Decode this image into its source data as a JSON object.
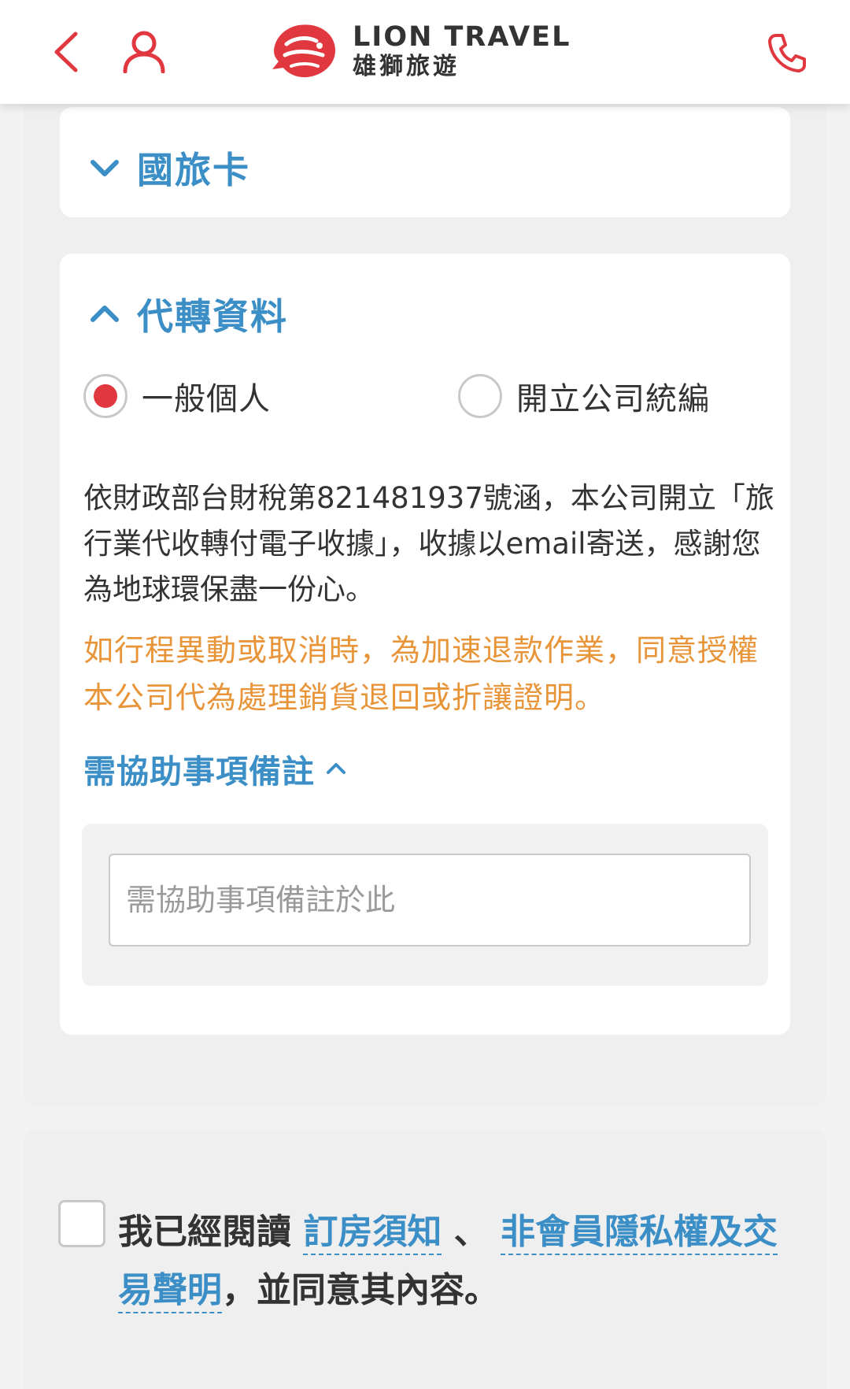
{
  "header": {
    "logo_en": "LION TRAVEL",
    "logo_zh": "雄獅旅遊",
    "icons": [
      "chevron-left-icon",
      "user-icon",
      "phone-icon"
    ],
    "accent_color": "#e1373f"
  },
  "travel_card": {
    "title": "國旅卡",
    "expanded": false
  },
  "agent_section": {
    "title": "代轉資料",
    "expanded": true,
    "options": [
      {
        "label": "一般個人",
        "selected": true
      },
      {
        "label": "開立公司統編",
        "selected": false
      }
    ],
    "description": "依財政部台財稅第821481937號涵，本公司開立「旅行業代收轉付電子收據」，收據以email寄送，感謝您為地球環保盡一份心。",
    "notice": "如行程異動或取消時，為加速退款作業，同意授權本公司代為處理銷貨退回或折讓證明。",
    "assist_toggle": "需協助事項備註",
    "assist_placeholder": "需協助事項備註於此"
  },
  "agreement": {
    "prefix": "我已經閱讀",
    "link1": "訂房須知",
    "separator": "、",
    "link2": "非會員隱私權及交易聲明",
    "suffix": "，並同意其內容。"
  },
  "colors": {
    "link_blue": "#3c8fc6",
    "notice_orange": "#e8953a",
    "radio_red": "#e1373f"
  }
}
